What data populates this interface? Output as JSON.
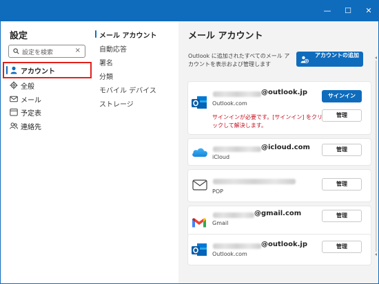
{
  "window": {
    "minimize": "—",
    "maximize": "☐",
    "close": "✕"
  },
  "sidebar": {
    "title": "設定",
    "search_placeholder": "設定を検索",
    "items": [
      {
        "label": "アカウント",
        "icon": "person-icon",
        "active": true
      },
      {
        "label": "全般",
        "icon": "gear-icon"
      },
      {
        "label": "メール",
        "icon": "mail-icon"
      },
      {
        "label": "予定表",
        "icon": "calendar-icon"
      },
      {
        "label": "連絡先",
        "icon": "contacts-icon"
      }
    ]
  },
  "subnav": {
    "items": [
      {
        "label": "メール アカウント",
        "active": true
      },
      {
        "label": "自動応答"
      },
      {
        "label": "署名"
      },
      {
        "label": "分類"
      },
      {
        "label": "モバイル デバイス"
      },
      {
        "label": "ストレージ"
      }
    ]
  },
  "main": {
    "title": "メール アカウント",
    "description": "Outlook に追加されたすべてのメール アカウントを表示および管理します",
    "add_account_button": "アカウントの追加",
    "accounts": [
      {
        "email_domain": "@outlook.jp",
        "provider": "Outlook.com",
        "icon": "outlook-icon",
        "signin_button": "サインイン",
        "manage_button": "管理",
        "error": "サインインが必要です。[サインイン] をクリックして解決します。"
      },
      {
        "email_domain": "@icloud.com",
        "provider": "iCloud",
        "icon": "icloud-icon",
        "manage_button": "管理"
      },
      {
        "email_domain": "",
        "provider": "POP",
        "icon": "envelope-icon",
        "manage_button": "管理"
      },
      {
        "email_domain": "@gmail.com",
        "provider": "Gmail",
        "icon": "gmail-icon",
        "manage_button": "管理"
      },
      {
        "email_domain": "@outlook.jp",
        "provider": "Outlook.com",
        "icon": "outlook-icon",
        "manage_button": "管理"
      }
    ]
  },
  "colors": {
    "accent": "#0f6cbd",
    "highlight": "#e0201b",
    "error": "#c50f1f",
    "pane_bg": "#f3f3f3"
  }
}
